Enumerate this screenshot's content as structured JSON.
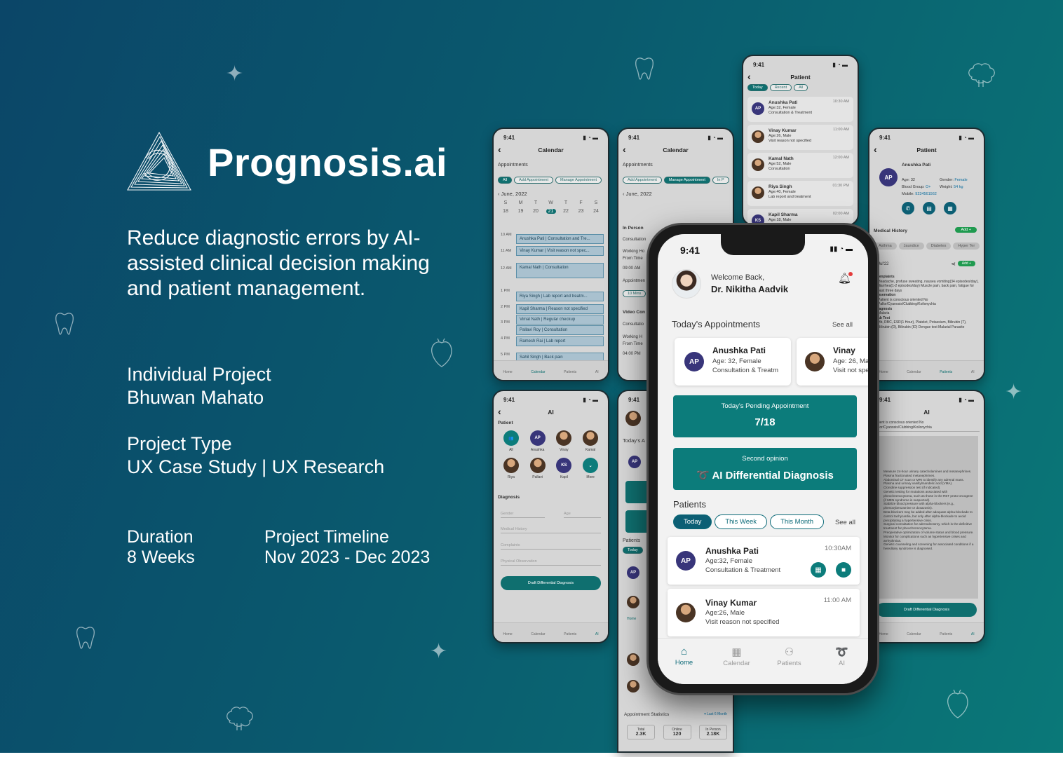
{
  "brand": {
    "title": "Prognosis.ai"
  },
  "tagline": "Reduce diagnostic errors by AI-assisted clinical decision making and patient management.",
  "project": {
    "line1": "Individual Project",
    "line2": "Bhuwan Mahato"
  },
  "type": {
    "label": "Project Type",
    "value": "UX Case Study | UX Research"
  },
  "duration": {
    "label": "Duration",
    "value": "8 Weeks"
  },
  "timeline": {
    "label": "Project Timeline",
    "value": "Nov 2023 - Dec 2023"
  },
  "colors": {
    "bg_start": "#0b4668",
    "bg_end": "#0a7878",
    "accent": "#0c7c7b"
  },
  "calendar_screen": {
    "time": "9:41",
    "title": "Calendar",
    "section": "Appointments",
    "filters": [
      "All",
      "Add Appointment",
      "Manage Appointment"
    ],
    "month": "June, 2022",
    "days": [
      "S",
      "M",
      "T",
      "W",
      "T",
      "F",
      "S"
    ],
    "dates": [
      "18",
      "19",
      "20",
      "21",
      "22",
      "23",
      "24"
    ],
    "times": [
      "10 AM",
      "11 AM",
      "12 AM",
      "1 PM",
      "2 PM",
      "3 PM",
      "4 PM",
      "5 PM"
    ],
    "slots": [
      "Anushka Pati | Consultation and Tre...",
      "Vinay Kumar | Visit reason not spec...",
      "Kamal Nath | Consultation",
      "Riya Singh | Lab report and treatm...",
      "Kapil Sharma | Reason not specified",
      "Vimal Nath | Regular checkup",
      "Pallavi Roy | Consultation",
      "Ramesh Rai | Lab report",
      "Sahil Singh | Back pain"
    ],
    "nav": [
      "Home",
      "Calendar",
      "Patients",
      "AI"
    ]
  },
  "manage_screen": {
    "time": "9:41",
    "title": "Calendar",
    "section": "Appointments",
    "filters": [
      "Add Appointment",
      "Manage Appointment",
      "In P"
    ],
    "month": "June, 2022",
    "in_person": "In Person",
    "consultation": "Consultation",
    "working": "Working Ho",
    "from_time": "From Time",
    "from_val": "09:00 AM",
    "appointment": "Appointmen",
    "mins": "10 Mins",
    "video": "Video Con",
    "consult2": "Consultatio",
    "working2": "Working H",
    "from2": "From Time",
    "from_val2": "04:00 PM"
  },
  "patient_list_screen": {
    "time": "9:41",
    "title": "Patient",
    "filters": [
      "Today",
      "Recent",
      "All"
    ],
    "patients": [
      {
        "name": "Anushka Pati",
        "meta": "Age:32, Female",
        "reason": "Consultation & Treatment",
        "time": "10:30 AM",
        "initials": "AP"
      },
      {
        "name": "Vinay Kumar",
        "meta": "Age:26, Male",
        "reason": "Visit reason not specified",
        "time": "11:00 AM"
      },
      {
        "name": "Kamal Nath",
        "meta": "Age:52, Male",
        "reason": "Consultation",
        "time": "12:00 AM"
      },
      {
        "name": "Riya Singh",
        "meta": "Age:40, Female",
        "reason": "Lab report and treatment",
        "time": "01:30 PM"
      },
      {
        "name": "Kapil Sharma",
        "meta": "Age:18, Male",
        "reason": "",
        "time": "02:00 AM",
        "initials": "KS"
      }
    ]
  },
  "patient_detail_screen": {
    "time": "9:41",
    "title": "Patient",
    "name": "Anushka Pati",
    "initials": "AP",
    "age": "Age: 32",
    "gender_label": "Gender:",
    "gender": "Female",
    "blood_label": "Blood Group:",
    "blood": "O+",
    "weight_label": "Weight:",
    "weight": "54 kg",
    "mobile_label": "Mobile:",
    "mobile": "9234561562",
    "history": "Medical History",
    "add": "Add +",
    "conditions": [
      "Asthma",
      "Jaundice",
      "Diabetes",
      "Hyper Ter"
    ],
    "date": "Jul'22",
    "complaints": "omplaints",
    "complaint_text": "Headache, profuse sweating, nausea vomiting(34 episodes/day), diarrhea(1-2 episodes/day) Muscle pain, back pain, fatigue for past three days",
    "observation": "bservation",
    "obs_text": "Patient is conscious oriented No Pallor/Cyanosis/Clubbing/Koilonychia",
    "diagnosis": "iagnosis",
    "diag_text": "Malaria",
    "lab": "ab Test",
    "lab_text": "Hb, RBC, ESR(1 Hour), Platelet, Potassium, Bilirubin (T), Bilirubin (D), Bilirubin (ID) Dengue test Malarial Parasite",
    "nav": [
      "Home",
      "Calendar",
      "Patients",
      "AI"
    ]
  },
  "ai_screen": {
    "time": "9:41",
    "title": "AI",
    "patient_label": "Patient",
    "patients": [
      "All",
      "Anushka",
      "Vinay",
      "Kamal",
      "Riya",
      "Pallavi",
      "Kapil",
      "More"
    ],
    "diagnosis": "Diagnosis",
    "fields": [
      "Gender",
      "Age",
      "Medical History",
      "Complaints",
      "Physical Observation"
    ],
    "button": "Draft Differential Diagnosis",
    "nav": [
      "Home",
      "Calendar",
      "Patients",
      "AI"
    ]
  },
  "home_bg_screen": {
    "time": "9:41",
    "today": "Today's A",
    "patients": "Patients",
    "today_pill": "Today",
    "stats_title": "Appointment Statistics",
    "stats_filter": "Last 6 Month",
    "stats": [
      {
        "label": "Total",
        "value": "2.3K"
      },
      {
        "label": "Online",
        "value": "120"
      },
      {
        "label": "In Person",
        "value": "2.18K"
      }
    ],
    "nav_home": "Home"
  },
  "ai_result_screen": {
    "time": "9:41",
    "title": "AI",
    "obs_text": "Patient is conscious oriented No Pallor/Cyanosis/Clubbing/Koilonychia",
    "list": [
      "Measure 24-hour urinary catecholamines and metanephrines.",
      "Plasma fractionated metanephrines.",
      "Abdominal CT scan or MRI to identify any adrenal mass.",
      "Plasma and urinary vanillylmandelic acid (VMA).",
      "Clonidine suppression test (if indicated).",
      "Genetic testing for mutations associated with pheochromocytoma, such as those in the RET proto-oncogene (if MEN syndrome is suspected).",
      "Stabilize blood pressure with alpha-blockers (e.g., phenoxybenzamine or doxazosin).",
      "Beta-blockers may be added after adequate alpha-blockade to control tachycardia, but only after alpha-blockade to avoid precipitating a hypertensive crisis.",
      "Surgical consultation for adrenalectomy, which is the definitive treatment for pheochromocytoma.",
      "Preoperative optimization of volume status and blood pressure.",
      "Monitor for complications such as hypertensive crises and arrhythmias.",
      "Genetic counseling and screening for associated conditions if a hereditary syndrome is diagnosed."
    ],
    "button": "Draft Differential Diagnosis",
    "nav": [
      "Home",
      "Calendar",
      "Patients",
      "AI"
    ]
  },
  "main_phone": {
    "time": "9:41",
    "welcome": "Welcome Back,",
    "doctor": "Dr. Nikitha Aadvik",
    "todays_title": "Today's Appointments",
    "see_all": "See all",
    "appointments": [
      {
        "initials": "AP",
        "name": "Anushka Pati",
        "meta": "Age: 32, Female",
        "reason": "Consultation & Treatm"
      },
      {
        "name": "Vinay",
        "meta": "Age: 26, Ma",
        "reason": "Visit not spe"
      }
    ],
    "pending_label": "Today's Pending Appointment",
    "pending_value": "7/18",
    "second_label": "Second opinion",
    "second_value": "AI Differential Diagnosis",
    "patients_title": "Patients",
    "tabs": [
      "Today",
      "This Week",
      "This Month"
    ],
    "patients": [
      {
        "initials": "AP",
        "name": "Anushka Pati",
        "meta": "Age:32, Female",
        "reason": "Consultation & Treatment",
        "time": "10:30AM"
      },
      {
        "name": "Vinay Kumar",
        "meta": "Age:26, Male",
        "reason": "Visit reason not specified",
        "time": "11:00 AM"
      }
    ],
    "nav": [
      "Home",
      "Calendar",
      "Patients",
      "AI"
    ]
  }
}
